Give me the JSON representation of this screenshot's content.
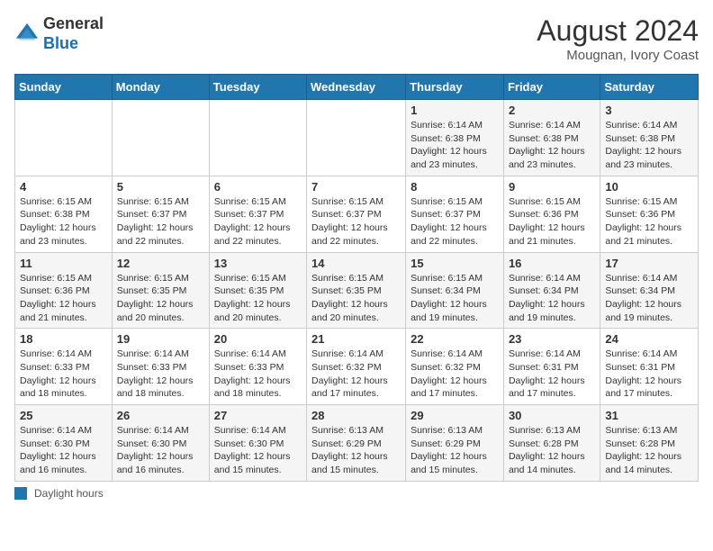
{
  "header": {
    "logo_general": "General",
    "logo_blue": "Blue",
    "month_year": "August 2024",
    "location": "Mougnan, Ivory Coast"
  },
  "footer": {
    "daylight_label": "Daylight hours"
  },
  "days_of_week": [
    "Sunday",
    "Monday",
    "Tuesday",
    "Wednesday",
    "Thursday",
    "Friday",
    "Saturday"
  ],
  "weeks": [
    [
      {
        "day": "",
        "info": ""
      },
      {
        "day": "",
        "info": ""
      },
      {
        "day": "",
        "info": ""
      },
      {
        "day": "",
        "info": ""
      },
      {
        "day": "1",
        "info": "Sunrise: 6:14 AM\nSunset: 6:38 PM\nDaylight: 12 hours\nand 23 minutes."
      },
      {
        "day": "2",
        "info": "Sunrise: 6:14 AM\nSunset: 6:38 PM\nDaylight: 12 hours\nand 23 minutes."
      },
      {
        "day": "3",
        "info": "Sunrise: 6:14 AM\nSunset: 6:38 PM\nDaylight: 12 hours\nand 23 minutes."
      }
    ],
    [
      {
        "day": "4",
        "info": "Sunrise: 6:15 AM\nSunset: 6:38 PM\nDaylight: 12 hours\nand 23 minutes."
      },
      {
        "day": "5",
        "info": "Sunrise: 6:15 AM\nSunset: 6:37 PM\nDaylight: 12 hours\nand 22 minutes."
      },
      {
        "day": "6",
        "info": "Sunrise: 6:15 AM\nSunset: 6:37 PM\nDaylight: 12 hours\nand 22 minutes."
      },
      {
        "day": "7",
        "info": "Sunrise: 6:15 AM\nSunset: 6:37 PM\nDaylight: 12 hours\nand 22 minutes."
      },
      {
        "day": "8",
        "info": "Sunrise: 6:15 AM\nSunset: 6:37 PM\nDaylight: 12 hours\nand 22 minutes."
      },
      {
        "day": "9",
        "info": "Sunrise: 6:15 AM\nSunset: 6:36 PM\nDaylight: 12 hours\nand 21 minutes."
      },
      {
        "day": "10",
        "info": "Sunrise: 6:15 AM\nSunset: 6:36 PM\nDaylight: 12 hours\nand 21 minutes."
      }
    ],
    [
      {
        "day": "11",
        "info": "Sunrise: 6:15 AM\nSunset: 6:36 PM\nDaylight: 12 hours\nand 21 minutes."
      },
      {
        "day": "12",
        "info": "Sunrise: 6:15 AM\nSunset: 6:35 PM\nDaylight: 12 hours\nand 20 minutes."
      },
      {
        "day": "13",
        "info": "Sunrise: 6:15 AM\nSunset: 6:35 PM\nDaylight: 12 hours\nand 20 minutes."
      },
      {
        "day": "14",
        "info": "Sunrise: 6:15 AM\nSunset: 6:35 PM\nDaylight: 12 hours\nand 20 minutes."
      },
      {
        "day": "15",
        "info": "Sunrise: 6:15 AM\nSunset: 6:34 PM\nDaylight: 12 hours\nand 19 minutes."
      },
      {
        "day": "16",
        "info": "Sunrise: 6:14 AM\nSunset: 6:34 PM\nDaylight: 12 hours\nand 19 minutes."
      },
      {
        "day": "17",
        "info": "Sunrise: 6:14 AM\nSunset: 6:34 PM\nDaylight: 12 hours\nand 19 minutes."
      }
    ],
    [
      {
        "day": "18",
        "info": "Sunrise: 6:14 AM\nSunset: 6:33 PM\nDaylight: 12 hours\nand 18 minutes."
      },
      {
        "day": "19",
        "info": "Sunrise: 6:14 AM\nSunset: 6:33 PM\nDaylight: 12 hours\nand 18 minutes."
      },
      {
        "day": "20",
        "info": "Sunrise: 6:14 AM\nSunset: 6:33 PM\nDaylight: 12 hours\nand 18 minutes."
      },
      {
        "day": "21",
        "info": "Sunrise: 6:14 AM\nSunset: 6:32 PM\nDaylight: 12 hours\nand 17 minutes."
      },
      {
        "day": "22",
        "info": "Sunrise: 6:14 AM\nSunset: 6:32 PM\nDaylight: 12 hours\nand 17 minutes."
      },
      {
        "day": "23",
        "info": "Sunrise: 6:14 AM\nSunset: 6:31 PM\nDaylight: 12 hours\nand 17 minutes."
      },
      {
        "day": "24",
        "info": "Sunrise: 6:14 AM\nSunset: 6:31 PM\nDaylight: 12 hours\nand 17 minutes."
      }
    ],
    [
      {
        "day": "25",
        "info": "Sunrise: 6:14 AM\nSunset: 6:30 PM\nDaylight: 12 hours\nand 16 minutes."
      },
      {
        "day": "26",
        "info": "Sunrise: 6:14 AM\nSunset: 6:30 PM\nDaylight: 12 hours\nand 16 minutes."
      },
      {
        "day": "27",
        "info": "Sunrise: 6:14 AM\nSunset: 6:30 PM\nDaylight: 12 hours\nand 15 minutes."
      },
      {
        "day": "28",
        "info": "Sunrise: 6:13 AM\nSunset: 6:29 PM\nDaylight: 12 hours\nand 15 minutes."
      },
      {
        "day": "29",
        "info": "Sunrise: 6:13 AM\nSunset: 6:29 PM\nDaylight: 12 hours\nand 15 minutes."
      },
      {
        "day": "30",
        "info": "Sunrise: 6:13 AM\nSunset: 6:28 PM\nDaylight: 12 hours\nand 14 minutes."
      },
      {
        "day": "31",
        "info": "Sunrise: 6:13 AM\nSunset: 6:28 PM\nDaylight: 12 hours\nand 14 minutes."
      }
    ]
  ]
}
